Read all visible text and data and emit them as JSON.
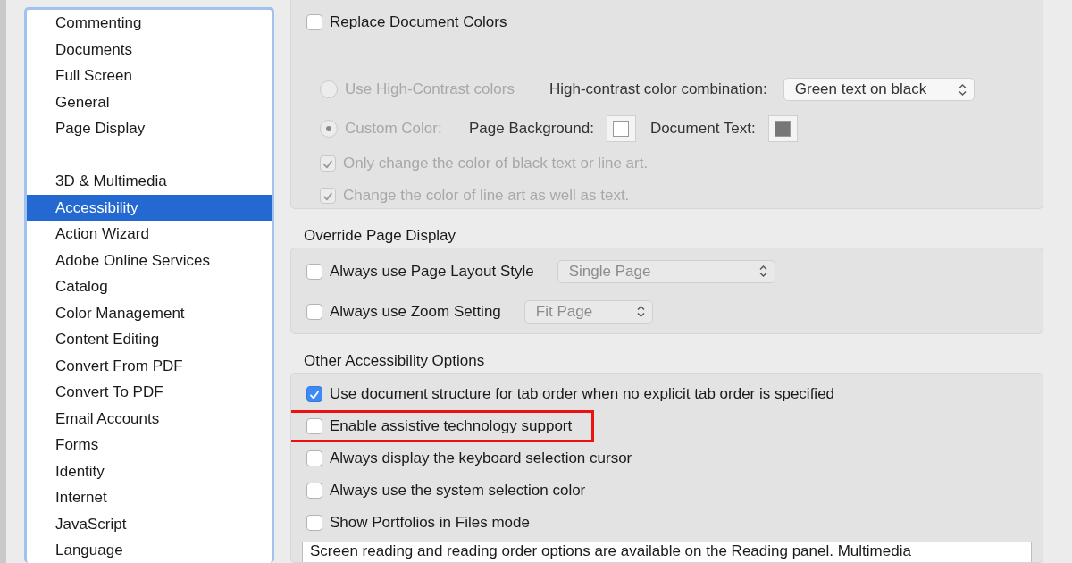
{
  "sidebar": {
    "groups": [
      {
        "items": [
          {
            "label": "Commenting",
            "selected": false
          },
          {
            "label": "Documents",
            "selected": false
          },
          {
            "label": "Full Screen",
            "selected": false
          },
          {
            "label": "General",
            "selected": false
          },
          {
            "label": "Page Display",
            "selected": false
          }
        ]
      },
      {
        "items": [
          {
            "label": "3D & Multimedia",
            "selected": false
          },
          {
            "label": "Accessibility",
            "selected": true
          },
          {
            "label": "Action Wizard",
            "selected": false
          },
          {
            "label": "Adobe Online Services",
            "selected": false
          },
          {
            "label": "Catalog",
            "selected": false
          },
          {
            "label": "Color Management",
            "selected": false
          },
          {
            "label": "Content Editing",
            "selected": false
          },
          {
            "label": "Convert From PDF",
            "selected": false
          },
          {
            "label": "Convert To PDF",
            "selected": false
          },
          {
            "label": "Email Accounts",
            "selected": false
          },
          {
            "label": "Forms",
            "selected": false
          },
          {
            "label": "Identity",
            "selected": false
          },
          {
            "label": "Internet",
            "selected": false
          },
          {
            "label": "JavaScript",
            "selected": false
          },
          {
            "label": "Language",
            "selected": false
          }
        ]
      }
    ]
  },
  "replace_colors": {
    "checkbox": {
      "label": "Replace Document Colors",
      "checked": false
    },
    "high_contrast": {
      "label": "Use High-Contrast colors",
      "selected": false,
      "disabled": true,
      "combo_label": "High-contrast color combination:",
      "combo_value": "Green text on black"
    },
    "custom": {
      "label": "Custom Color:",
      "selected": true,
      "disabled": true,
      "swatches": [
        {
          "label": "Page Background:",
          "color": "#ffffff"
        },
        {
          "label": "Document Text:",
          "color": "#777777"
        }
      ]
    },
    "options": [
      {
        "label": "Only change the color of black text or line art.",
        "checked": true,
        "disabled": true
      },
      {
        "label": "Change the color of line art as well as text.",
        "checked": true,
        "disabled": true
      }
    ]
  },
  "override_page_display": {
    "title": "Override Page Display",
    "rows": [
      {
        "label": "Always use Page Layout Style",
        "checked": false,
        "select_value": "Single Page",
        "select_disabled": true
      },
      {
        "label": "Always use Zoom Setting",
        "checked": false,
        "select_value": "Fit Page",
        "select_disabled": true
      }
    ]
  },
  "other_options": {
    "title": "Other Accessibility Options",
    "rows": [
      {
        "label": "Use document structure for tab order when no explicit tab order is specified",
        "checked": true,
        "highlighted": false
      },
      {
        "label": "Enable assistive technology support",
        "checked": false,
        "highlighted": true
      },
      {
        "label": "Always display the keyboard selection cursor",
        "checked": false,
        "highlighted": false
      },
      {
        "label": "Always use the system selection color",
        "checked": false,
        "highlighted": false
      },
      {
        "label": "Show Portfolios in Files mode",
        "checked": false,
        "highlighted": false
      }
    ],
    "info_text": "Screen reading and reading order options are available on the Reading panel. Multimedia"
  }
}
